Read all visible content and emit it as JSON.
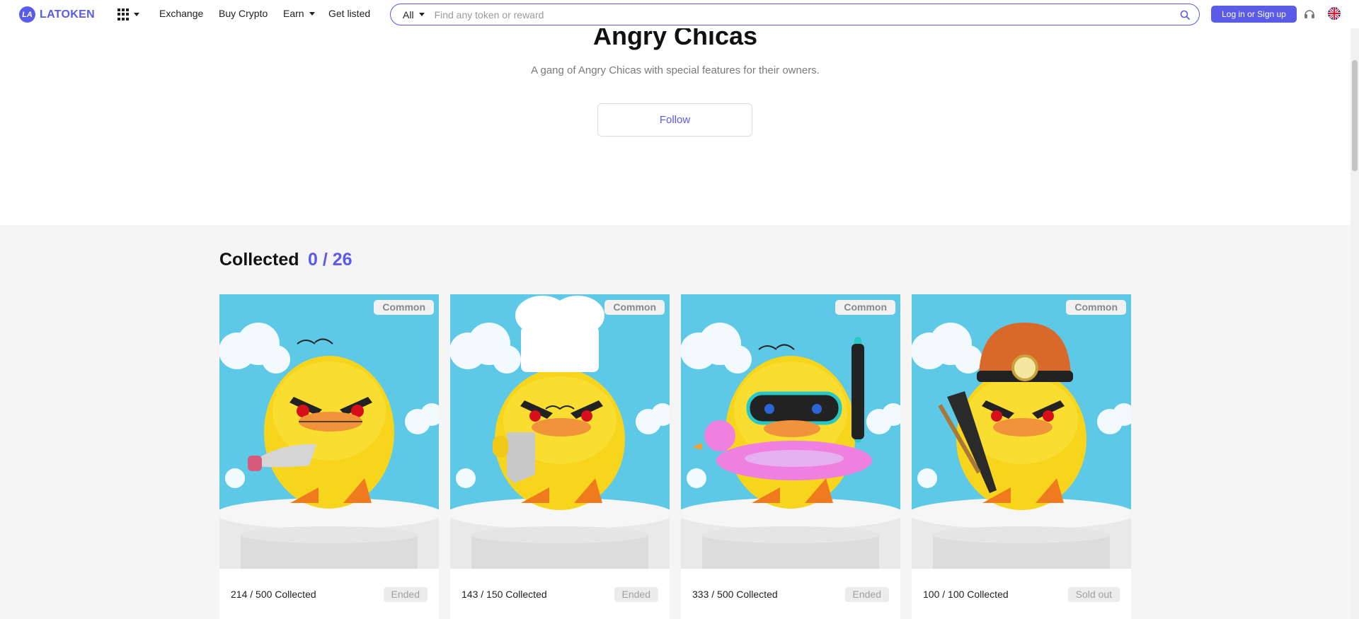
{
  "header": {
    "logo_badge": "LA",
    "logo_text": "LATOKEN",
    "nav": [
      "Exchange",
      "Buy Crypto",
      "Earn",
      "Get listed"
    ],
    "search": {
      "scope": "All",
      "placeholder": "Find any token or reward"
    },
    "login_label": "Log in or Sign up"
  },
  "hero": {
    "title": "Angry Chicas",
    "subtitle": "A gang of Angry Chicas with special features for their owners.",
    "follow_label": "Follow"
  },
  "collection": {
    "heading": "Collected",
    "count": "0 / 26",
    "cards": [
      {
        "rarity": "Common",
        "collected": "214 / 500 Collected",
        "status": "Ended",
        "accessory": "knife"
      },
      {
        "rarity": "Common",
        "collected": "143 / 150 Collected",
        "status": "Ended",
        "accessory": "chef"
      },
      {
        "rarity": "Common",
        "collected": "333 / 500 Collected",
        "status": "Ended",
        "accessory": "snorkel"
      },
      {
        "rarity": "Common",
        "collected": "100 / 100 Collected",
        "status": "Sold out",
        "accessory": "miner"
      }
    ]
  },
  "colors": {
    "accent": "#5a5be6",
    "card_bg": "#5ec9e6",
    "chick": "#f7d51d",
    "section_bg": "#f5f5f6"
  }
}
